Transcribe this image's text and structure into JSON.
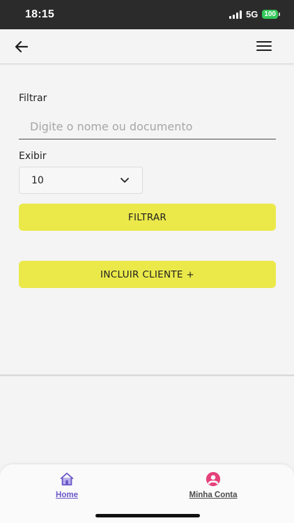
{
  "status_bar": {
    "time": "18:15",
    "network": "5G",
    "battery": "100",
    "battery_color": "#34c759"
  },
  "app_bar": {
    "back_icon": "arrow-left-icon",
    "menu_icon": "hamburger-menu-icon"
  },
  "filter": {
    "label": "Filtrar",
    "search_value": "",
    "search_placeholder": "Digite o nome ou documento"
  },
  "display": {
    "label": "Exibir",
    "selected": "10",
    "chevron_icon": "chevron-down-icon"
  },
  "buttons": {
    "filter_label": "FILTRAR",
    "add_client_label": "INCLUIR CLIENTE +",
    "accent_color": "#ebe94a"
  },
  "bottom_nav": {
    "items": [
      {
        "label": "Home",
        "icon": "home-icon",
        "active": true,
        "color": "#6b57c9"
      },
      {
        "label": "Minha Conta",
        "icon": "user-icon",
        "active": false,
        "color": "#e5417a"
      }
    ]
  }
}
